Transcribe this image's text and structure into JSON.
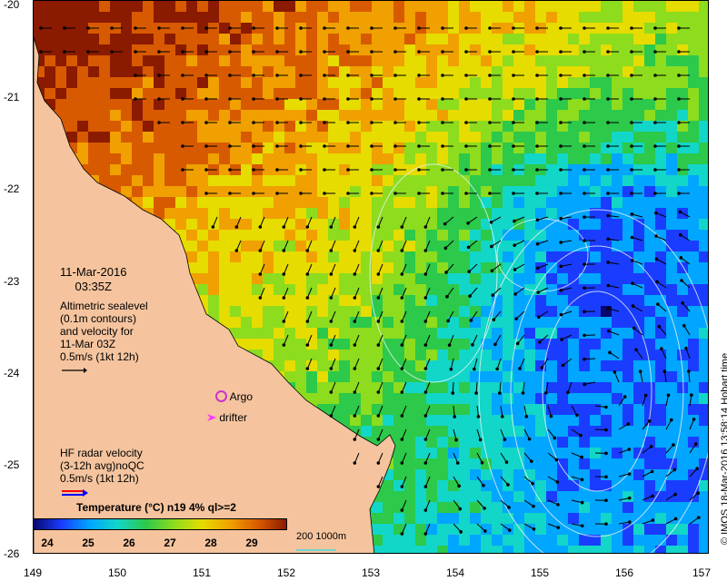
{
  "date_line1": "11-Mar-2016",
  "date_line2": "03:35Z",
  "altimetry_legend": [
    "Altimetric sealevel",
    "(0.1m contours)",
    "and velocity for",
    "11-Mar 03Z",
    "0.5m/s (1kt 12h)"
  ],
  "hf_legend": [
    "HF radar velocity",
    "(3-12h avg)noQC",
    "0.5m/s (1kt 12h)"
  ],
  "argo_label": "Argo",
  "drifter_label": "drifter",
  "colorbar_title": "Temperature (°C) n19 4% ql>=2",
  "colorbar_ticks": [
    "24",
    "25",
    "26",
    "27",
    "28",
    "29"
  ],
  "colorbar_colors": [
    "#08086e",
    "#1a3cff",
    "#00a6ff",
    "#12d6c8",
    "#2cc94a",
    "#8ddc1e",
    "#e6dc00",
    "#f0a000",
    "#d85a00",
    "#8a1a00"
  ],
  "contour_legend": "200 1000m",
  "credit": "© IMOS 18-Mar-2016 13:58:14 Hobart time",
  "lat_ticks": [
    "-20",
    "-21",
    "-22",
    "-23",
    "-24",
    "-25",
    "-26"
  ],
  "lon_ticks": [
    "149",
    "150",
    "151",
    "152",
    "153",
    "154",
    "155",
    "156",
    "157"
  ],
  "colors": {
    "land": "#f5c49e",
    "argo": "#cc33cc",
    "drifter": "#ff33ff",
    "hf_blue": "#0000ff",
    "hf_red": "#ff0000",
    "bathy": "#6fd3d3"
  }
}
